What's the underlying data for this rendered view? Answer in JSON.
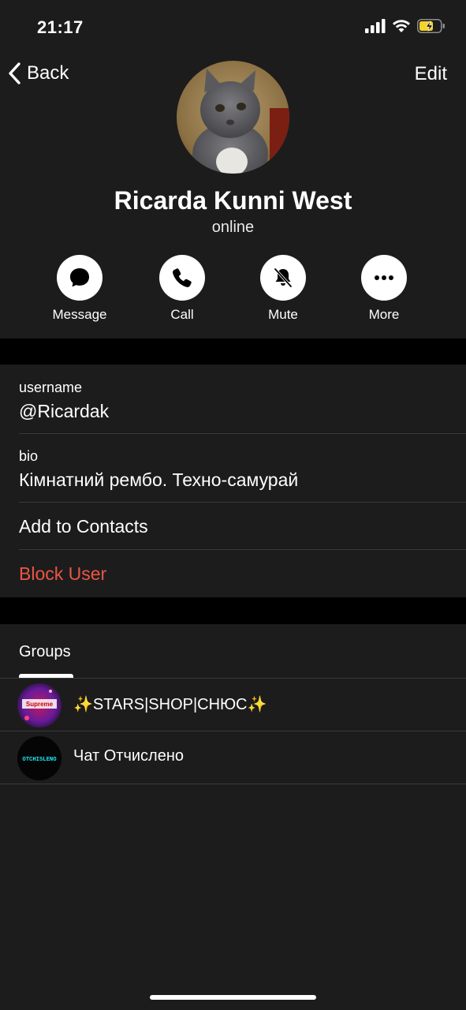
{
  "status_bar": {
    "time": "21:17",
    "battery_color": "#f6d22a"
  },
  "nav": {
    "back_label": "Back",
    "edit_label": "Edit"
  },
  "profile": {
    "name": "Ricarda Kunni West",
    "status": "online"
  },
  "actions": [
    {
      "label": "Message",
      "icon": "chat-bubble-icon"
    },
    {
      "label": "Call",
      "icon": "phone-icon"
    },
    {
      "label": "Mute",
      "icon": "bell-slash-icon"
    },
    {
      "label": "More",
      "icon": "ellipsis-icon"
    }
  ],
  "info": {
    "username_label": "username",
    "username_value": "@Ricardak",
    "bio_label": "bio",
    "bio_value": "Кімнатний рембо. Техно-самурай",
    "add_contacts": "Add to Contacts",
    "block_user": "Block User"
  },
  "groups": {
    "tab_label": "Groups",
    "items": [
      {
        "name": "✨STARS|SHOP|СНЮС✨",
        "avatar_text": "Supreme"
      },
      {
        "name": "Чат Отчислено",
        "avatar_text": "OTCHISLENO"
      }
    ]
  },
  "colors": {
    "background": "#1c1c1d",
    "separator": "#000000",
    "destructive": "#eb5545"
  }
}
